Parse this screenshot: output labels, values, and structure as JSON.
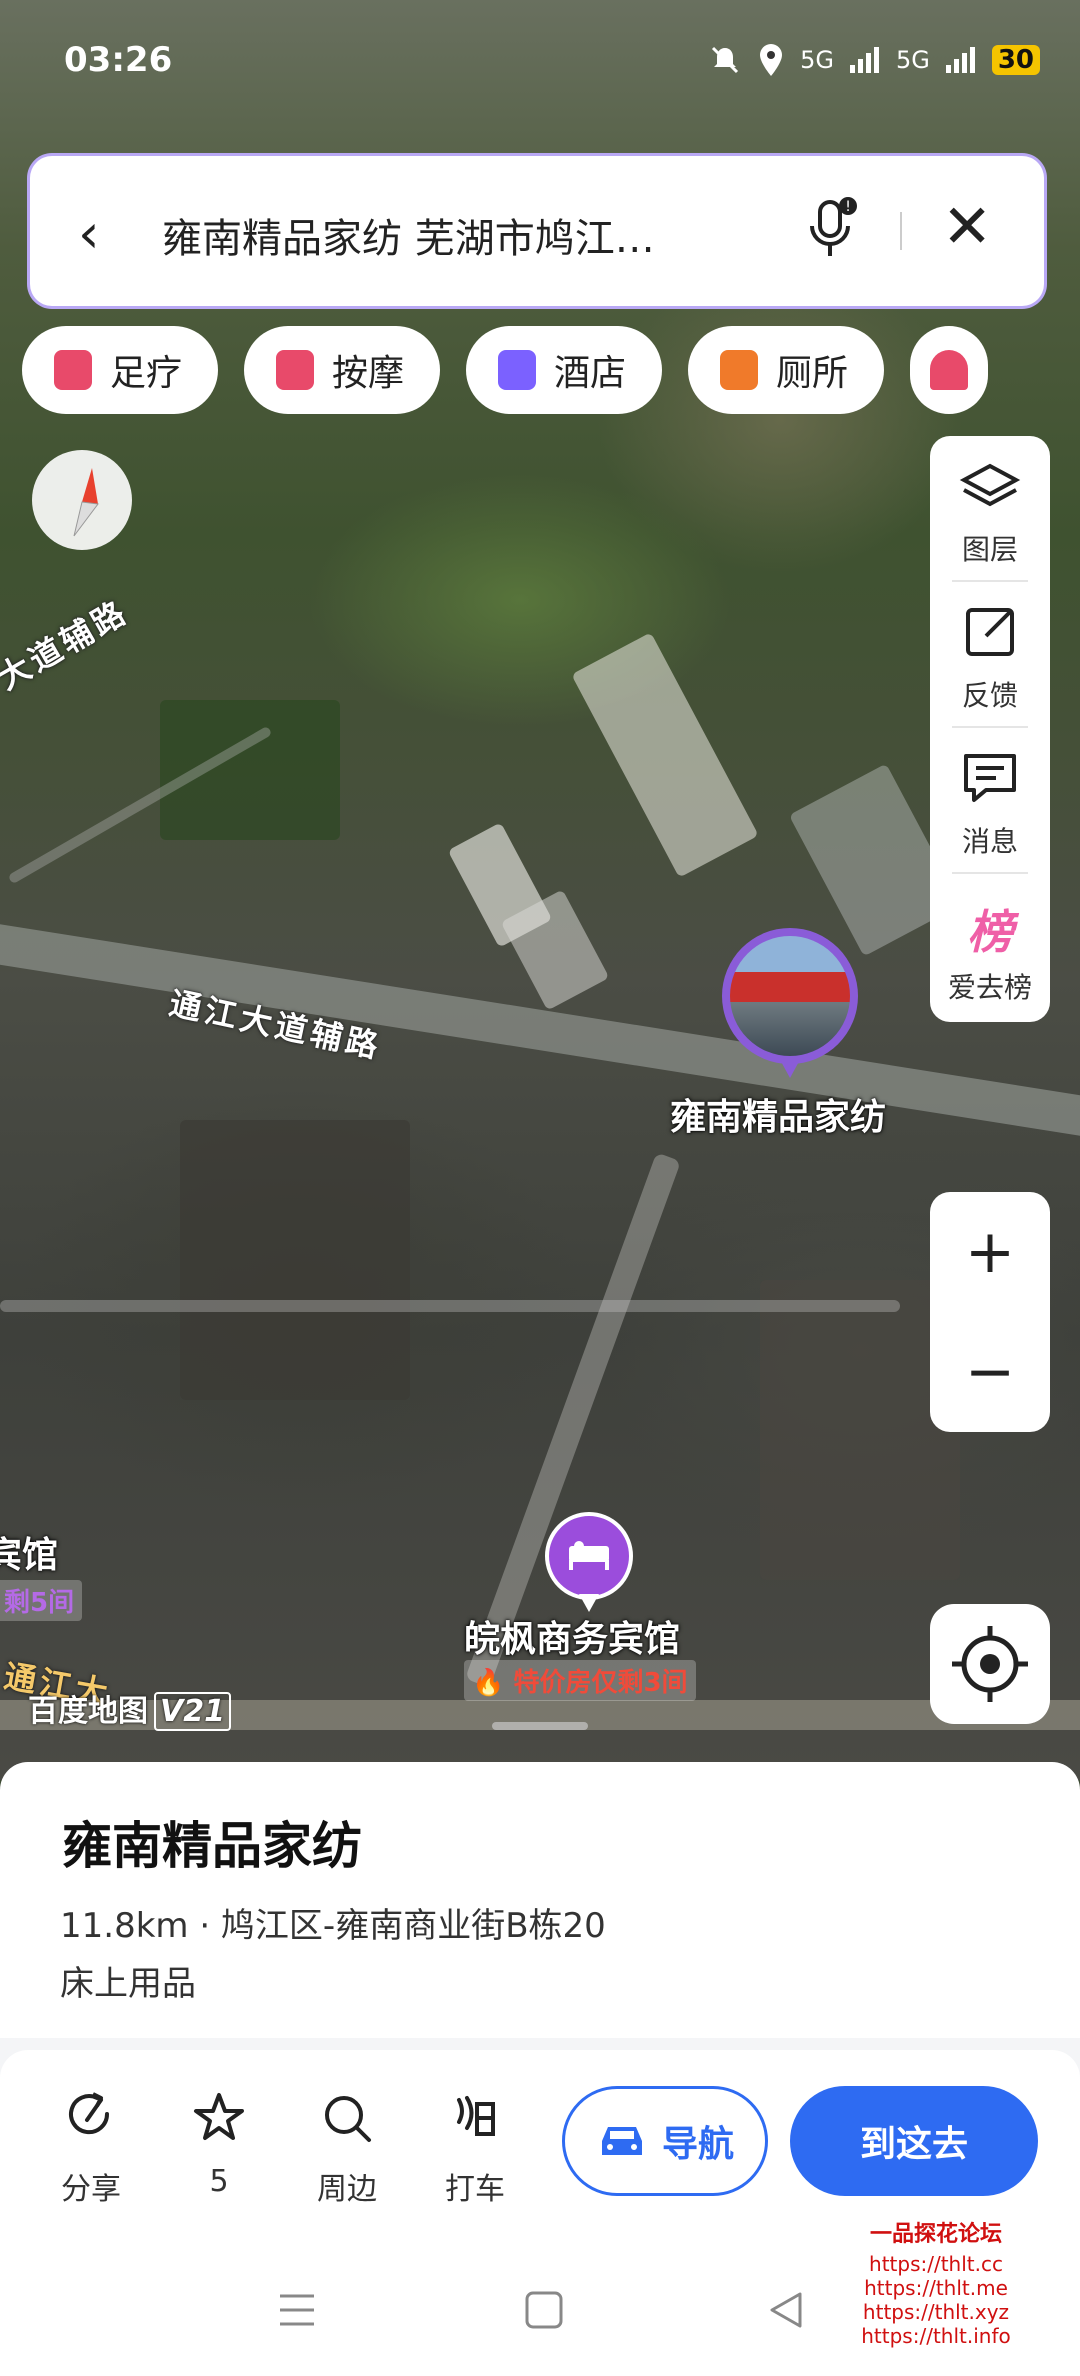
{
  "status_bar": {
    "time": "03:26",
    "battery": "30",
    "signal_1": "5G",
    "signal_2": "5G"
  },
  "search": {
    "query": "雍南精品家纺 芜湖市鸠江…"
  },
  "chips": [
    {
      "label": "足疗",
      "icon": "foot-massage-icon",
      "color": "#e84a6a"
    },
    {
      "label": "按摩",
      "icon": "massage-icon",
      "color": "#e84a6a"
    },
    {
      "label": "酒店",
      "icon": "hotel-icon",
      "color": "#7b61ff"
    },
    {
      "label": "厕所",
      "icon": "toilet-icon",
      "color": "#f07a2a"
    }
  ],
  "tools": [
    {
      "label": "图层",
      "icon": "layers-icon"
    },
    {
      "label": "反馈",
      "icon": "feedback-icon"
    },
    {
      "label": "消息",
      "icon": "message-icon"
    },
    {
      "label": "爱去榜",
      "icon": "ranking-icon",
      "glyph": "榜"
    }
  ],
  "zoom": {
    "in": "+",
    "out": "−"
  },
  "map": {
    "road_1": "通江大道辅路",
    "road_2": "大道辅路",
    "road_3": "通江大",
    "poi_main": "雍南精品家纺",
    "hotel_name": "皖枫商务宾馆",
    "hotel_deal": "特价房仅剩3间",
    "hotel_left": "宾馆",
    "hotel_left_deal": "剩5间",
    "brand": "百度地图",
    "brand_version": "V21"
  },
  "place": {
    "title": "雍南精品家纺",
    "subtitle": "11.8km · 鸠江区-雍南商业街B栋20",
    "category": "床上用品"
  },
  "actions": {
    "share": "分享",
    "favorite_count": "5",
    "nearby": "周边",
    "taxi": "打车",
    "navigate": "导航",
    "go_here": "到这去"
  },
  "watermark": {
    "title": "一品探花论坛",
    "urls": [
      "https://thlt.cc",
      "https://thlt.me",
      "https://thlt.xyz",
      "https://thlt.info"
    ]
  }
}
